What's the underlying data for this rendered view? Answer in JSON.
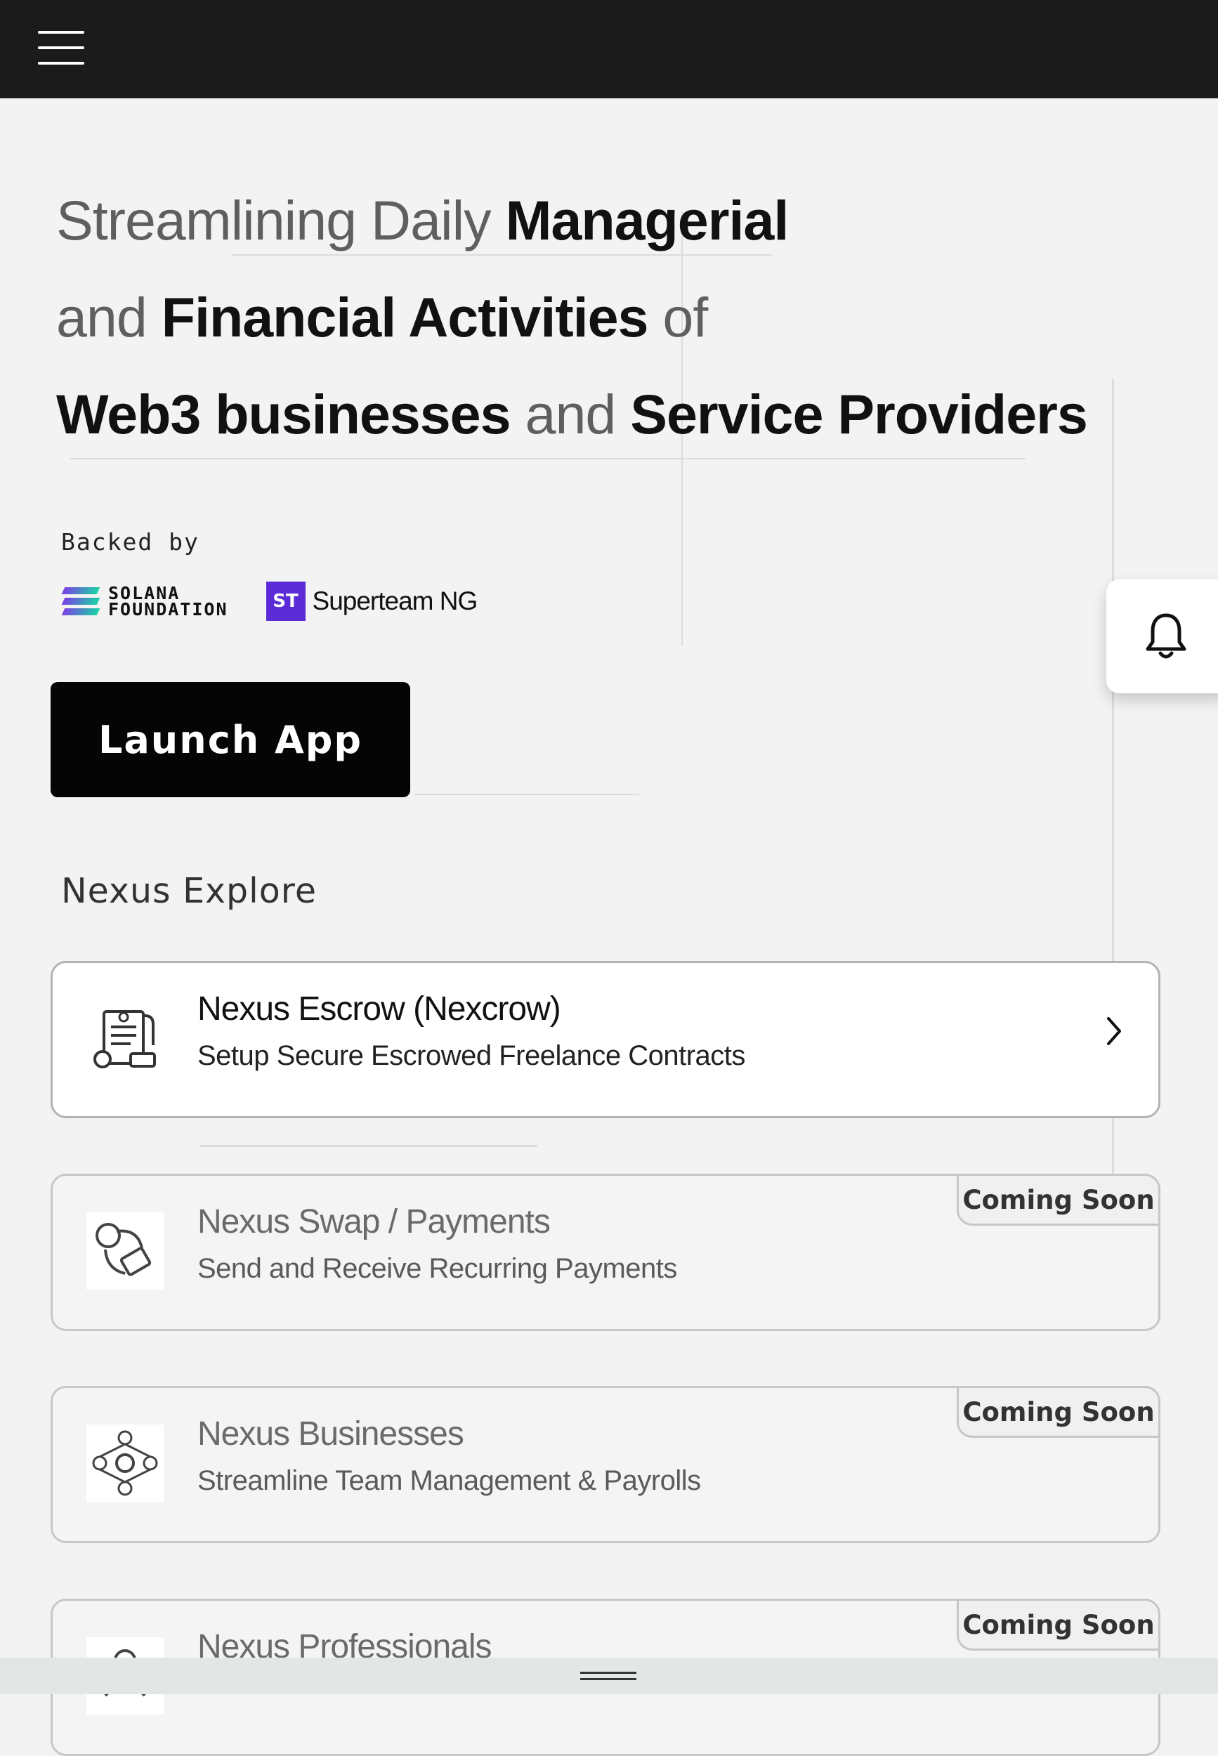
{
  "header": {
    "menu_icon": "hamburger-icon"
  },
  "hero": {
    "line1_a": "Streamlining Daily ",
    "line1_b": "Managerial",
    "line2_a": "and ",
    "line2_b": "Financial Activities",
    "line2_c": " of",
    "line3_a": "Web3 businesses",
    "line3_b": " and ",
    "line3_c": "Service Providers"
  },
  "backed": {
    "label": "Backed by",
    "solana_line1": "SOLANA",
    "solana_line2": "FOUNDATION",
    "superteam_badge": "ST",
    "superteam_name": "Superteam NG"
  },
  "launch_button": "Launch App",
  "notification_icon": "bell-icon",
  "explore": {
    "title": "Nexus Explore",
    "cards": [
      {
        "title": "Nexus Escrow (Nexcrow)",
        "subtitle": "Setup Secure Escrowed Freelance Contracts",
        "icon": "escrow-document-icon"
      },
      {
        "title": "Nexus Swap / Payments",
        "subtitle": "Send and Receive Recurring Payments",
        "badge": "Coming Soon",
        "icon": "swap-payments-icon"
      },
      {
        "title": "Nexus Businesses",
        "subtitle": "Streamline Team Management & Payrolls",
        "badge": "Coming Soon",
        "icon": "business-network-icon"
      },
      {
        "title": "Nexus Professionals",
        "badge": "Coming Soon",
        "icon": "professional-icon"
      }
    ]
  },
  "colors": {
    "topbar": "#1b1b1b",
    "button": "#050505",
    "solana_gradient_start": "#7b3fe4",
    "solana_gradient_end": "#19d4a6",
    "superteam": "#5a2bd6"
  }
}
